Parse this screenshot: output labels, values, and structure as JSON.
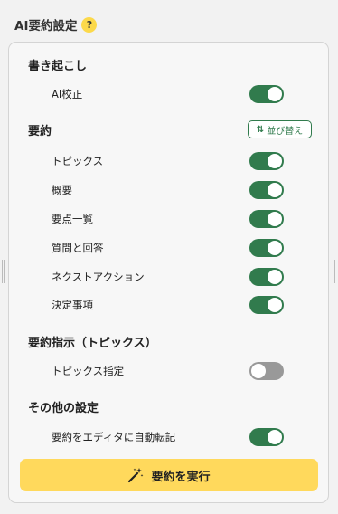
{
  "header": {
    "title": "AI要約設定",
    "help_glyph": "?"
  },
  "sections": {
    "transcription": {
      "title": "書き起こし",
      "items": [
        {
          "label": "AI校正",
          "on": true
        }
      ]
    },
    "summary": {
      "title": "要約",
      "sort_label": "並び替え",
      "sort_icon_glyph": "⇅",
      "items": [
        {
          "label": "トピックス",
          "on": true
        },
        {
          "label": "概要",
          "on": true
        },
        {
          "label": "要点一覧",
          "on": true
        },
        {
          "label": "質問と回答",
          "on": true
        },
        {
          "label": "ネクストアクション",
          "on": true
        },
        {
          "label": "決定事項",
          "on": true
        }
      ]
    },
    "instructions": {
      "title": "要約指示（トピックス）",
      "items": [
        {
          "label": "トピックス指定",
          "on": false
        }
      ]
    },
    "other": {
      "title": "その他の設定",
      "items": [
        {
          "label": "要約をエディタに自動転記",
          "on": true
        }
      ]
    }
  },
  "run_button": {
    "label": "要約を実行",
    "icon": "magic-wand-icon"
  },
  "colors": {
    "toggle_on": "#317b4d",
    "toggle_off": "#999999",
    "accent_yellow": "#ffd95c",
    "help_yellow": "#fcd94a"
  }
}
